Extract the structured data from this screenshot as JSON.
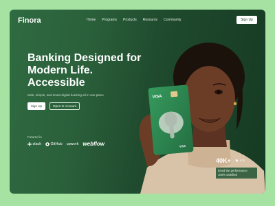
{
  "brand": {
    "name": "Finora"
  },
  "nav": {
    "items": [
      "Home",
      "Programs",
      "Products",
      "Resource",
      "Community"
    ],
    "signup_label": "Sign Up"
  },
  "hero": {
    "headline_lines": [
      "Banking Designed for",
      "Modern Life.",
      "Accessible"
    ],
    "subtext": "Safe, simple, and smart digital banking all in one place",
    "primary_button": "Sign Up",
    "secondary_button": "Open In Account"
  },
  "featured": {
    "label": "Futured in",
    "brands": [
      "slack",
      "GitHub",
      "upwork",
      "webflow"
    ]
  },
  "card": {
    "network": "VISA",
    "network_small": "VISA"
  },
  "stats": {
    "value": "40K+",
    "rating": "4.9",
    "line1": "loved the performance",
    "line2": "100% satisfied"
  },
  "colors": {
    "page_bg": "#a6e3a2",
    "hero_green": "#2a5f3a",
    "dark_green": "#163a23",
    "card_green": "#2e8a52"
  }
}
